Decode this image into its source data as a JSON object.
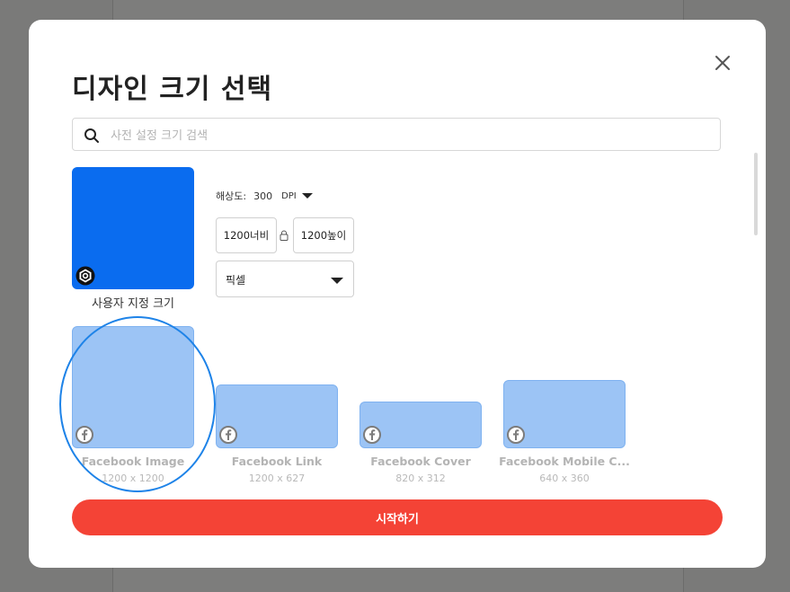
{
  "dialog": {
    "title": "디자인 크기 선택",
    "close_icon": "close-icon"
  },
  "search": {
    "placeholder": "사전 설정 크기 검색",
    "value": "",
    "icon": "search-icon"
  },
  "custom_size": {
    "label": "사용자 지정 크기",
    "tile_color": "#0A6CEF",
    "badge_icon": "settings-hex-icon",
    "resolution_label": "해상도:",
    "resolution_value": "300",
    "resolution_unit": "DPI",
    "width_value": "1200너비",
    "height_value": "1200높이",
    "lock_icon": "lock-icon",
    "unit_selected": "픽셀"
  },
  "presets": [
    {
      "name": "Facebook Image",
      "size": "1200 x 1200",
      "icon": "facebook-icon",
      "highlighted": true
    },
    {
      "name": "Facebook Link",
      "size": "1200 x 627",
      "icon": "facebook-icon"
    },
    {
      "name": "Facebook Cover",
      "size": "820 x 312",
      "icon": "facebook-icon"
    },
    {
      "name": "Facebook Mobile C...",
      "size": "640 x 360",
      "icon": "facebook-icon"
    }
  ],
  "actions": {
    "start_label": "시작하기",
    "start_color": "#F44336"
  },
  "colors": {
    "preset_fill": "#9CC4F5",
    "highlight_ring": "#1E83E8"
  }
}
